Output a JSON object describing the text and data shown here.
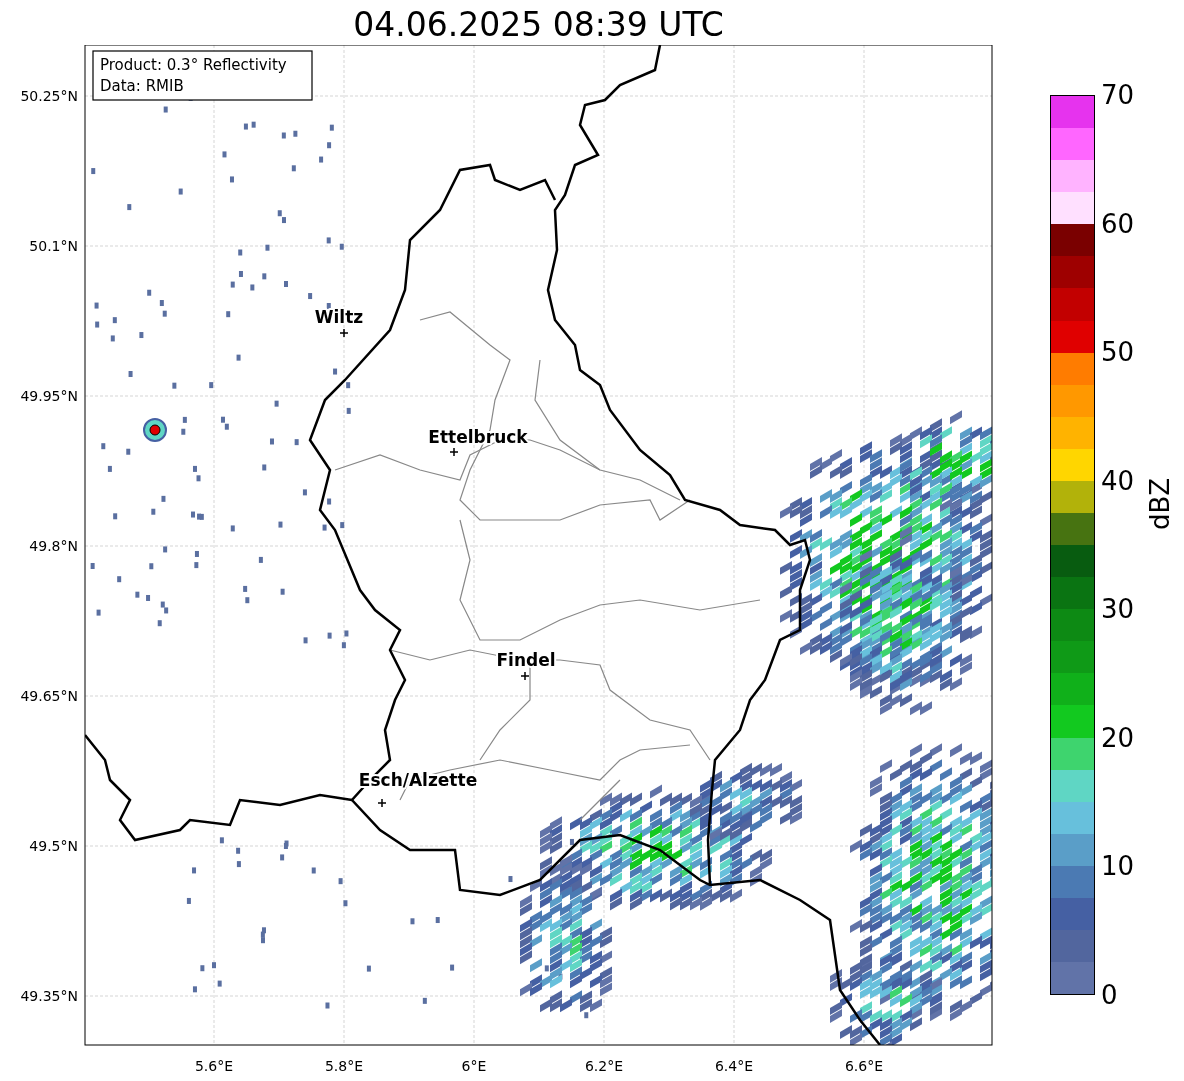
{
  "title": "04.06.2025 08:39 UTC",
  "info_box": [
    "Product: 0.3° Reflectivity",
    "Data: RMIB"
  ],
  "lat_ticks": [
    "50.25°N",
    "50.1°N",
    "49.95°N",
    "49.8°N",
    "49.65°N",
    "49.5°N",
    "49.35°N"
  ],
  "lon_ticks": [
    "5.6°E",
    "5.8°E",
    "6°E",
    "6.2°E",
    "6.4°E",
    "6.6°E"
  ],
  "cities": [
    {
      "name": "Wiltz"
    },
    {
      "name": "Ettelbruck"
    },
    {
      "name": "Findel"
    },
    {
      "name": "Esch/Alzette"
    }
  ],
  "colorbar": {
    "label": "dBZ",
    "ticks": [
      "70",
      "60",
      "50",
      "40",
      "30",
      "20",
      "10",
      "0"
    ],
    "bands": [
      {
        "color": "#e633ee"
      },
      {
        "color": "#ff66ff"
      },
      {
        "color": "#ffb3ff"
      },
      {
        "color": "#ffe0ff"
      },
      {
        "color": "#7a0000"
      },
      {
        "color": "#9e0000"
      },
      {
        "color": "#c20000"
      },
      {
        "color": "#e00000"
      },
      {
        "color": "#ff7c00"
      },
      {
        "color": "#ff9800"
      },
      {
        "color": "#ffb300"
      },
      {
        "color": "#ffd600"
      },
      {
        "color": "#b2b20a"
      },
      {
        "color": "#477311"
      },
      {
        "color": "#085c10"
      },
      {
        "color": "#0a7412"
      },
      {
        "color": "#0d8a14"
      },
      {
        "color": "#0f9a17"
      },
      {
        "color": "#10b01a"
      },
      {
        "color": "#12c91f"
      },
      {
        "color": "#3ed46e"
      },
      {
        "color": "#5fd6c4"
      },
      {
        "color": "#67c0dc"
      },
      {
        "color": "#5a9ec8"
      },
      {
        "color": "#4b7ab3"
      },
      {
        "color": "#4560a3"
      },
      {
        "color": "#52669e"
      },
      {
        "color": "#6173a8"
      }
    ]
  }
}
